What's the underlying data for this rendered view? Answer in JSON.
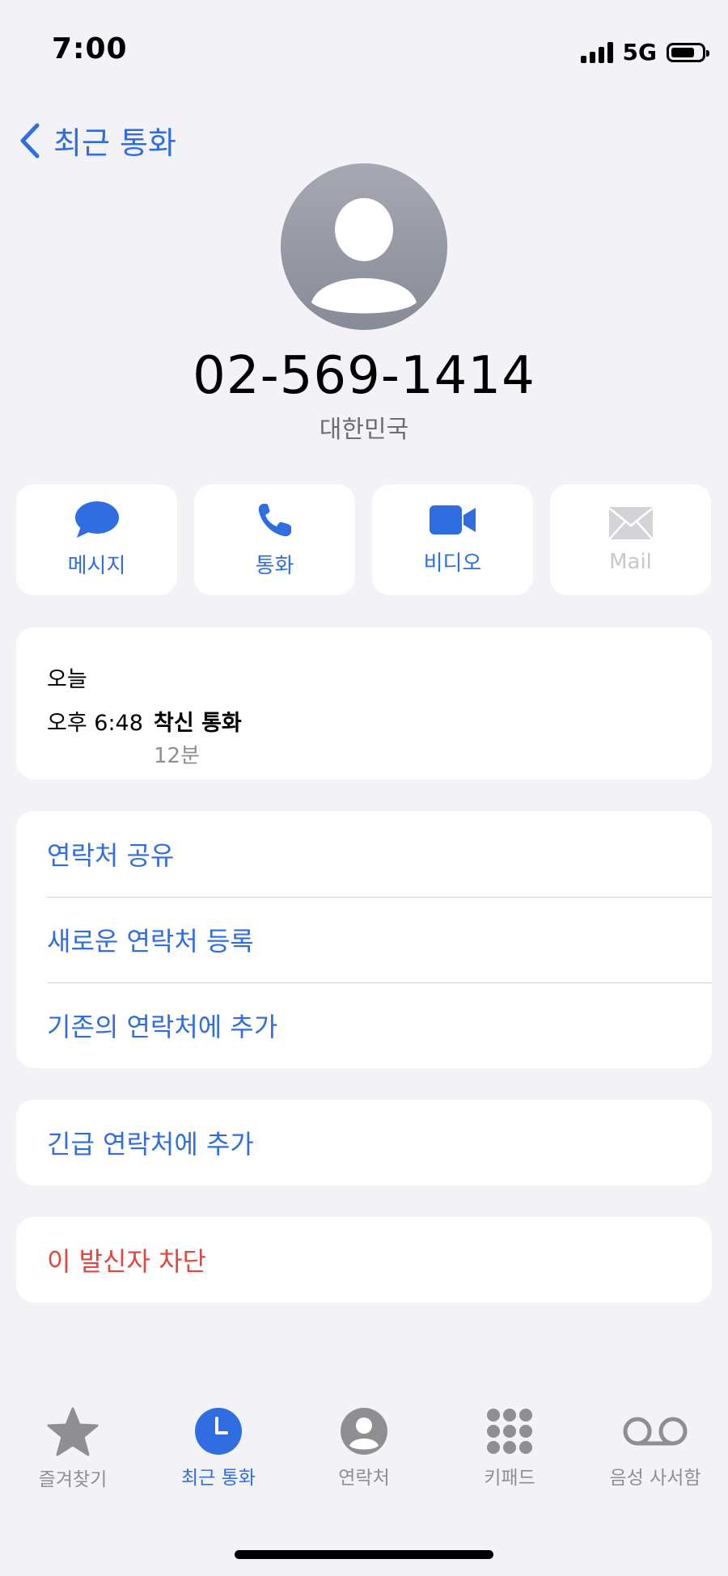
{
  "status": {
    "time": "7:00",
    "network": "5G"
  },
  "nav": {
    "back_label": "최근 통화"
  },
  "contact": {
    "number": "02-569-1414",
    "region": "대한민국"
  },
  "actions": [
    {
      "label": "메시지",
      "icon": "message-icon"
    },
    {
      "label": "통화",
      "icon": "phone-icon"
    },
    {
      "label": "비디오",
      "icon": "video-icon"
    },
    {
      "label": "Mail",
      "icon": "mail-icon"
    }
  ],
  "recent": {
    "day": "오늘",
    "time": "오후 6:48",
    "type": "착신 통화",
    "duration": "12분"
  },
  "options": {
    "share_contact": "연락처 공유",
    "new_contact": "새로운 연락처 등록",
    "add_existing": "기존의 연락처에 추가",
    "add_emergency": "긴급 연락처에 추가",
    "block_caller": "이 발신자 차단"
  },
  "tabs": [
    {
      "label": "즐겨찾기",
      "icon": "star-icon"
    },
    {
      "label": "최근 통화",
      "icon": "clock-icon"
    },
    {
      "label": "연락처",
      "icon": "person-circle-icon"
    },
    {
      "label": "키패드",
      "icon": "keypad-icon"
    },
    {
      "label": "음성 사서함",
      "icon": "voicemail-icon"
    }
  ],
  "colors": {
    "accent": "#2f6de1",
    "danger": "#e3463c",
    "background": "#f2f2f7"
  }
}
